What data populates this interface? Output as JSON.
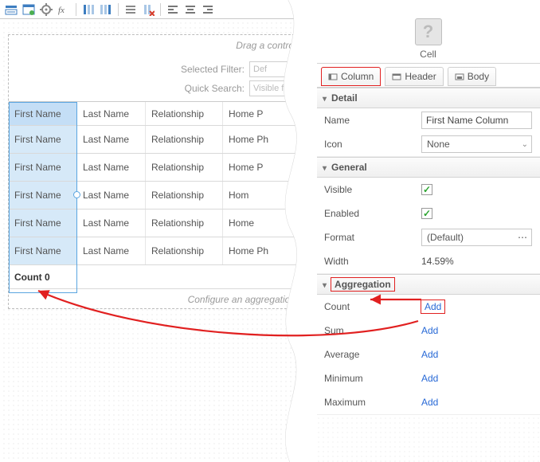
{
  "toolbar": {
    "icons": [
      "data-source",
      "form",
      "gear",
      "fx",
      "col-add-left",
      "col-add-right",
      "bars",
      "col-remove",
      "align-left",
      "align-center",
      "align-right"
    ]
  },
  "canvas": {
    "drag_hint": "Drag a contro",
    "selected_filter_label": "Selected Filter:",
    "selected_filter_value": "Def",
    "quick_search_label": "Quick Search:",
    "quick_search_value": "Visible fi",
    "config_hint": "Configure an aggregation",
    "summary": "Count 0"
  },
  "grid": {
    "headers": [
      "First Name",
      "Last Name",
      "Relationship",
      "Home P"
    ],
    "rows": [
      [
        "First Name",
        "Last Name",
        "Relationship",
        "Home Ph"
      ],
      [
        "First Name",
        "Last Name",
        "Relationship",
        "Home P"
      ],
      [
        "First Name",
        "Last Name",
        "Relationship",
        "Hom"
      ],
      [
        "First Name",
        "Last Name",
        "Relationship",
        "Home"
      ],
      [
        "First Name",
        "Last Name",
        "Relationship",
        "Home Ph"
      ]
    ]
  },
  "inspector": {
    "top_label": "Cell",
    "tabs": [
      "Column",
      "Header",
      "Body"
    ],
    "detail": {
      "title": "Detail",
      "name_label": "Name",
      "name_value": "First Name Column",
      "icon_label": "Icon",
      "icon_value": "None"
    },
    "general": {
      "title": "General",
      "visible_label": "Visible",
      "visible_checked": true,
      "enabled_label": "Enabled",
      "enabled_checked": true,
      "format_label": "Format",
      "format_value": "(Default)",
      "width_label": "Width",
      "width_value": "14.59%"
    },
    "aggregation": {
      "title": "Aggregation",
      "items": [
        {
          "label": "Count",
          "action": "Add"
        },
        {
          "label": "Sum",
          "action": "Add"
        },
        {
          "label": "Average",
          "action": "Add"
        },
        {
          "label": "Minimum",
          "action": "Add"
        },
        {
          "label": "Maximum",
          "action": "Add"
        }
      ]
    }
  }
}
